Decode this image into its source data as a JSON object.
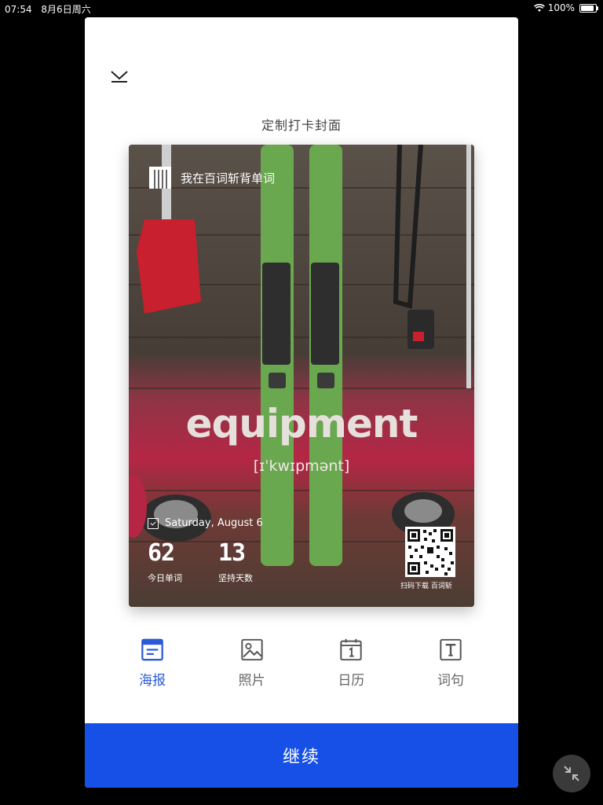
{
  "status_bar": {
    "time": "07:54",
    "date": "8月6日周六",
    "battery": "100%",
    "battery_level": 1.0
  },
  "sheet": {
    "title": "定制打卡封面"
  },
  "cover": {
    "brand_text": "我在百词斩背单词",
    "word": "equipment",
    "phonetic": "[ɪˈkwɪpmənt]",
    "date": "Saturday, August 6",
    "stats": [
      {
        "value": "62",
        "label": "今日单词"
      },
      {
        "value": "13",
        "label": "坚持天数"
      }
    ],
    "qr_caption_prefix": "扫码下载",
    "qr_caption_brand": "百词斩"
  },
  "tabs": [
    {
      "label": "海报",
      "icon": "poster-icon",
      "active": true
    },
    {
      "label": "照片",
      "icon": "photo-icon",
      "active": false
    },
    {
      "label": "日历",
      "icon": "calendar-icon",
      "active": false
    },
    {
      "label": "词句",
      "icon": "text-icon",
      "active": false
    }
  ],
  "continue_label": "继续",
  "colors": {
    "accent": "#1650e6",
    "active_tab": "#2b5bd7",
    "inactive_tab": "#666666"
  }
}
